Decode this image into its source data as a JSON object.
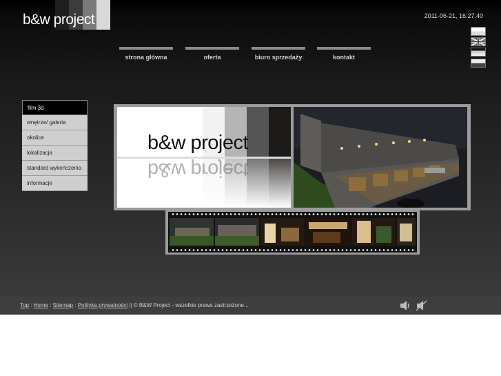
{
  "brand": {
    "logo_text": "b&w project"
  },
  "header": {
    "datetime": "2011-06-21, 16:27:40"
  },
  "languages": [
    {
      "name": "flag-1"
    },
    {
      "name": "flag-uk"
    },
    {
      "name": "flag-3"
    },
    {
      "name": "flag-4"
    }
  ],
  "nav": {
    "items": [
      {
        "label": "strona główna"
      },
      {
        "label": "oferta"
      },
      {
        "label": "biuro sprzedaży"
      },
      {
        "label": "kontakt"
      }
    ]
  },
  "side_menu": {
    "items": [
      {
        "label": "film 3d"
      },
      {
        "label": "wnętrze/ galeria"
      },
      {
        "label": "okolice"
      },
      {
        "label": "lokalizacja"
      },
      {
        "label": "standard wykończenia"
      },
      {
        "label": "informacje"
      }
    ]
  },
  "gallery": {
    "logo_text": "b&w project",
    "logo_reflection": "b&w project"
  },
  "footer": {
    "links": [
      "Top",
      "Home",
      "Sitemap",
      "Polityka prywatności"
    ],
    "separator": ":",
    "copyright": "|| © B&W Project - wszelkie prawa zastrzeżone..."
  },
  "colors": {
    "background": "#2a2a2a",
    "menu_bg": "#cfcfcf",
    "nav_bar": "#8a8a8a",
    "frame": "#9c9c9c"
  }
}
